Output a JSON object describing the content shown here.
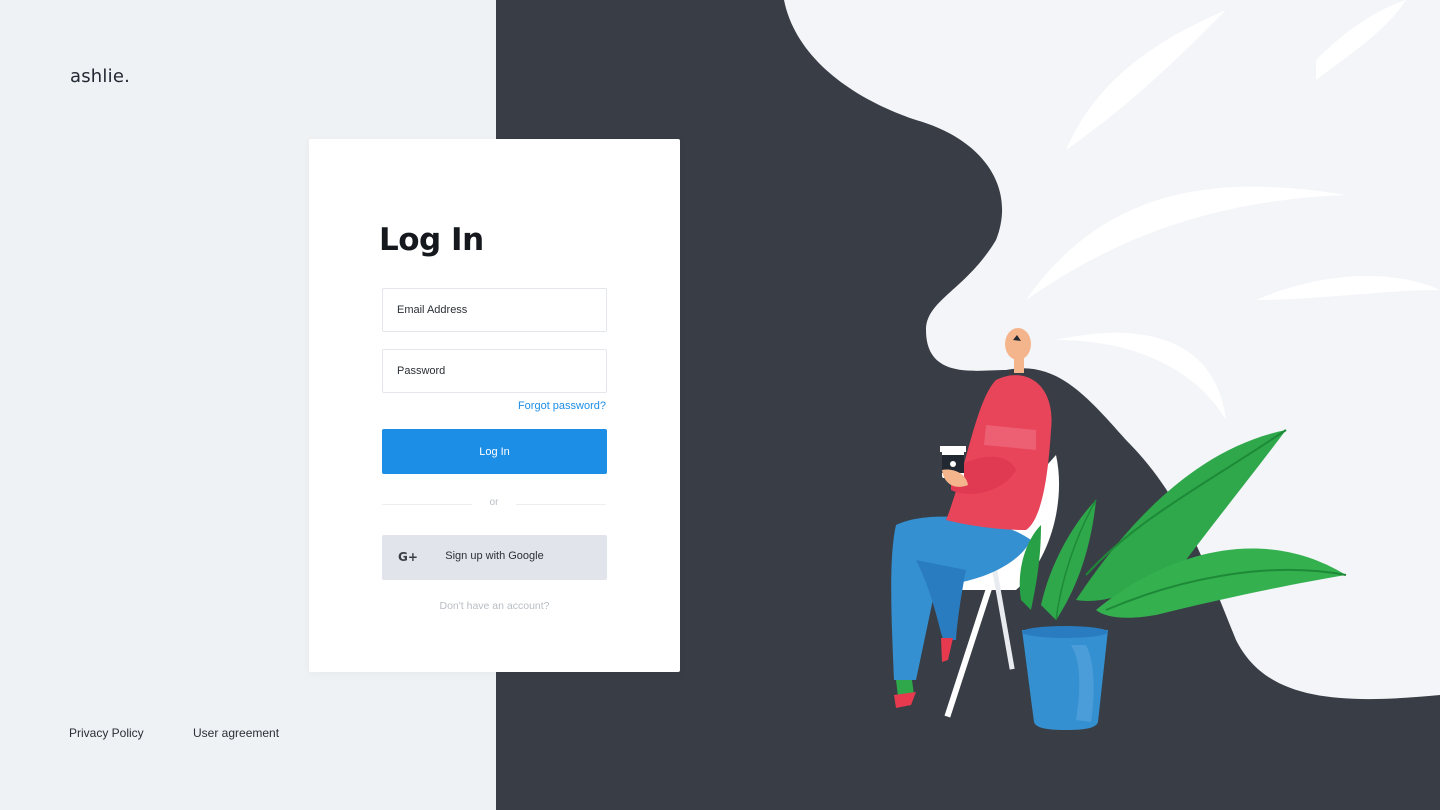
{
  "brand": {
    "logo_text": "ashlie."
  },
  "login": {
    "title": "Log In",
    "email_placeholder": "Email Address",
    "password_placeholder": "Password",
    "forgot_password": "Forgot password?",
    "login_button": "Log In",
    "divider": "or",
    "google_icon": "G+",
    "google_button": "Sign up with Google",
    "no_account": "Don't have an account?"
  },
  "footer": {
    "privacy": "Privacy Policy",
    "agreement": "User agreement"
  },
  "colors": {
    "accent": "#1d8ee6",
    "dark_panel": "#393e46",
    "light_panel": "#eff2f5",
    "google_button": "#e1e4ea"
  },
  "icons": {
    "google": "google-plus-icon"
  }
}
